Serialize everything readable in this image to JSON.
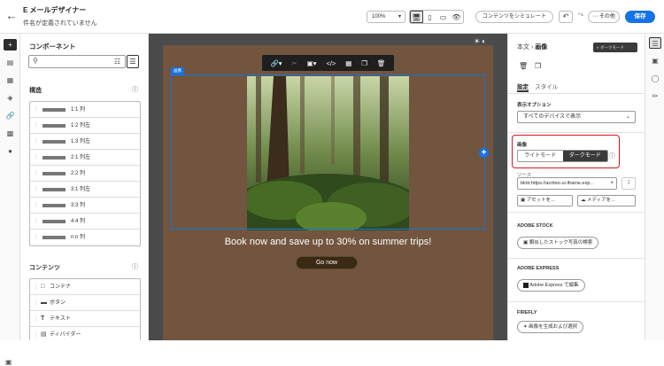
{
  "header": {
    "title": "E メールデザイナー",
    "subtitle": "件名が定義されていません",
    "zoom": "100%",
    "simulate_label": "コンテンツをシミュレート",
    "more_label": "その他",
    "save_label": "保存"
  },
  "components": {
    "title": "コンポーネント",
    "structure_heading": "構造",
    "structures": [
      "1:1 列",
      "1:2 列左",
      "1:3 列左",
      "2:1 列左",
      "2:2 列",
      "3:1 列左",
      "3:3 列",
      "4:4 列",
      "n:n 列"
    ],
    "content_heading": "コンテンツ",
    "contents": [
      "コンテナ",
      "ボタン",
      "テキスト",
      "ディバイダー"
    ]
  },
  "canvas": {
    "image_tag": "画像",
    "headline": "Book now and save up to 30% on summer trips!",
    "cta_label": "Go now"
  },
  "props": {
    "breadcrumb_root": "本文",
    "breadcrumb_current": "画像",
    "dark_mode_pill": "ダークモード",
    "tab_settings": "設定",
    "tab_style": "スタイル",
    "display_options_label": "表示オプション",
    "display_value": "すべてのデバイスで表示",
    "image_label": "画像",
    "light_mode": "ライトモード",
    "dark_mode": "ダークモード",
    "source_label": "ソース",
    "source_value": "blob:https://acrites-ui-iframe.exp...",
    "asset_button": "アセットを...",
    "media_button": "メディアを...",
    "adobe_stock_label": "ADOBE STOCK",
    "stock_button": "類似したストック写真の検索",
    "adobe_express_label": "ADOBE EXPRESS",
    "express_button": "Adobe Express で編集",
    "firefly_label": "FIREFLY",
    "firefly_button": "画像を生成および選択"
  },
  "colors": {
    "accent": "#1473e6",
    "email_bg": "#72553e",
    "highlight": "#d9141a"
  }
}
